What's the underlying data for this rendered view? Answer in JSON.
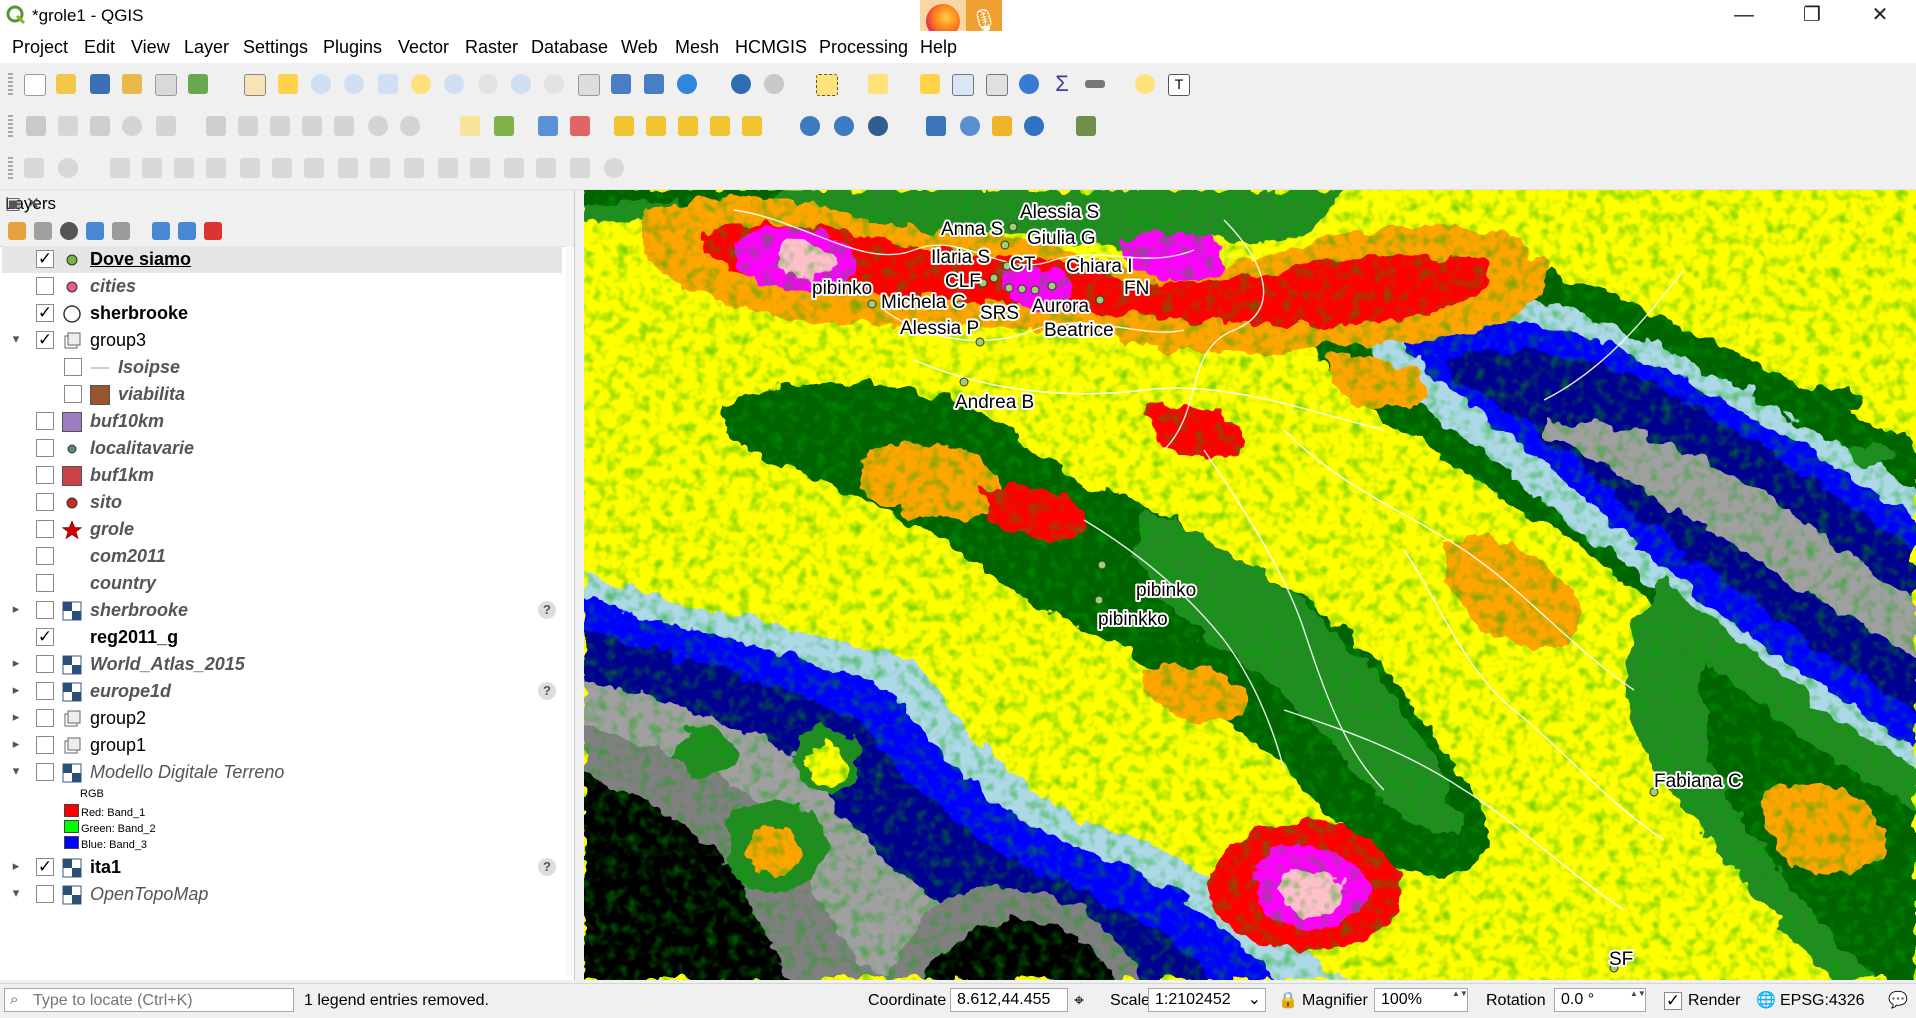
{
  "window": {
    "title": "*grole1 - QGIS",
    "controls": {
      "minimize": "—",
      "restore": "❐",
      "close": "✕"
    }
  },
  "taskbar_popup": {
    "browser_icon": "firefox-icon",
    "mic_icon": "microphone-icon",
    "mic_glyph": "🎙"
  },
  "menu": [
    "Project",
    "Edit",
    "View",
    "Layer",
    "Settings",
    "Plugins",
    "Vector",
    "Raster",
    "Database",
    "Web",
    "Mesh",
    "HCMGIS",
    "Processing",
    "Help"
  ],
  "layers_panel": {
    "title": "Layers",
    "panel_buttons": "▣ ✕",
    "items": [
      {
        "name": "Dove siamo",
        "checked": true,
        "style": "bold-underline",
        "symbol": "green-dot",
        "arrow": "",
        "check": "✓"
      },
      {
        "name": "cities",
        "checked": false,
        "style": "bold-italic-grey",
        "symbol": "pink-dot",
        "arrow": "",
        "check": ""
      },
      {
        "name": "sherbrooke",
        "checked": true,
        "style": "bold",
        "symbol": "hollow-circle",
        "arrow": "",
        "check": "✓"
      },
      {
        "name": "group3",
        "checked": true,
        "style": "normal",
        "symbol": "group",
        "arrow": "▾",
        "check": "✓"
      },
      {
        "name": "Isoipse",
        "checked": false,
        "style": "bold-italic-grey",
        "symbol": "line",
        "arrow": "",
        "check": ""
      },
      {
        "name": "viabilita",
        "checked": false,
        "style": "bold-italic-grey",
        "symbol": "brown-fill",
        "arrow": "",
        "check": ""
      },
      {
        "name": "buf10km",
        "checked": false,
        "style": "bold-italic-grey",
        "symbol": "purple-fill",
        "arrow": "",
        "check": ""
      },
      {
        "name": "localitavarie",
        "checked": false,
        "style": "bold-italic-grey",
        "symbol": "teal-dot",
        "arrow": "",
        "check": ""
      },
      {
        "name": "buf1km",
        "checked": false,
        "style": "bold-italic-grey",
        "symbol": "red-fill",
        "arrow": "",
        "check": ""
      },
      {
        "name": "sito",
        "checked": false,
        "style": "bold-italic-grey",
        "symbol": "red-dot",
        "arrow": "",
        "check": ""
      },
      {
        "name": "grole",
        "checked": false,
        "style": "bold-italic-grey",
        "symbol": "red-star",
        "arrow": "",
        "check": ""
      },
      {
        "name": "com2011",
        "checked": false,
        "style": "bold-italic-grey",
        "symbol": "none",
        "arrow": "",
        "check": ""
      },
      {
        "name": "country",
        "checked": false,
        "style": "bold-italic-grey",
        "symbol": "none",
        "arrow": "",
        "check": ""
      },
      {
        "name": "sherbrooke",
        "checked": false,
        "style": "bold-italic-grey",
        "symbol": "raster",
        "arrow": "▸",
        "check": "",
        "help": "?"
      },
      {
        "name": "reg2011_g",
        "checked": true,
        "style": "bold",
        "symbol": "none",
        "arrow": "",
        "check": "✓"
      },
      {
        "name": "World_Atlas_2015",
        "checked": false,
        "style": "bold-italic-grey",
        "symbol": "raster",
        "arrow": "▸",
        "check": ""
      },
      {
        "name": "europe1d",
        "checked": false,
        "style": "bold-italic-grey",
        "symbol": "raster",
        "arrow": "▸",
        "check": "",
        "help": "?"
      },
      {
        "name": "group2",
        "checked": false,
        "style": "normal",
        "symbol": "group",
        "arrow": "▸",
        "check": ""
      },
      {
        "name": "group1",
        "checked": false,
        "style": "normal",
        "symbol": "group",
        "arrow": "▸",
        "check": ""
      },
      {
        "name": "Modello Digitale Terreno",
        "checked": false,
        "style": "italic-grey",
        "symbol": "raster",
        "arrow": "▾",
        "check": ""
      },
      {
        "name": "ita1",
        "checked": true,
        "style": "bold",
        "symbol": "raster",
        "arrow": "▸",
        "check": "✓",
        "help": "?"
      },
      {
        "name": "OpenTopoMap",
        "checked": false,
        "style": "italic-grey",
        "symbol": "raster",
        "arrow": "▾",
        "check": ""
      }
    ],
    "dtm_legend": {
      "rgb": "RGB",
      "bands": [
        {
          "label": "Red:  Band_1",
          "color": "#ff0000"
        },
        {
          "label": "Green: Band_2",
          "color": "#00ff00"
        },
        {
          "label": "Blue:  Band_3",
          "color": "#0000ff"
        }
      ]
    }
  },
  "map": {
    "labels": [
      "Alessia S",
      "Anna S",
      "Giulia G",
      "Ilaria S",
      "CT",
      "Chiara I",
      "CLF",
      "FN",
      "pibinko",
      "Michela C",
      "SRS",
      "Aurora",
      "Alessia P",
      "Beatrice",
      "Andrea B",
      "pibinko",
      "pibinkko",
      "Fabiana C",
      "SF"
    ],
    "colors": {
      "sea_dark": "#0000a0",
      "sea": "#0000ff",
      "sea_light": "#add8e6",
      "grey": "#a0a0a0",
      "dark_green": "#006400",
      "green": "#228b22",
      "yellow": "#ffff00",
      "orange": "#ffa500",
      "red": "#ff0000",
      "magenta": "#ff00ff"
    }
  },
  "status": {
    "locate_placeholder": "Type to locate (Ctrl+K)",
    "search_icon": "⌕",
    "message": "1 legend entries removed.",
    "coordinate_label": "Coordinate",
    "coordinate": "8.612,44.455",
    "scale_label": "Scale",
    "scale": "1:2102452",
    "magnifier_label": "Magnifier",
    "magnifier": "100%",
    "rotation_label": "Rotation",
    "rotation": "0.0 °",
    "render_label": "Render",
    "render_checked": true,
    "render_check": "✓",
    "crs": "EPSG:4326",
    "lock_glyph": "🔒",
    "globe_glyph": "🌐",
    "msg_glyph": "💬",
    "spin_glyph": "▲▼",
    "dropdown_glyph": "⌄"
  }
}
